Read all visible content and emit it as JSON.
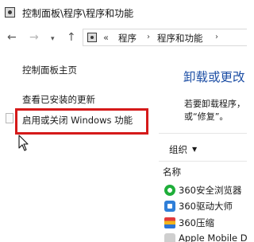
{
  "window": {
    "title": "控制面板\\程序\\程序和功能"
  },
  "navigation": {
    "back_icon": "←",
    "forward_icon": "→",
    "dropdown_icon": "▾",
    "up_icon": "↑"
  },
  "address_bar": {
    "overflow_chevron": "«",
    "segments": [
      "程序",
      "程序和功能"
    ],
    "separator": "›"
  },
  "left_pane": {
    "links": [
      "控制面板主页",
      "查看已安装的更新",
      "启用或关闭 Windows 功能"
    ]
  },
  "main": {
    "heading": "卸载或更改",
    "description_line1": "若要卸载程序，",
    "description_line2": "或“修复”。",
    "organize_label": "组织",
    "organize_arrow": "▼",
    "column_header": "名称",
    "programs": [
      {
        "name": "360安全浏览器",
        "icon": "360browser-icon"
      },
      {
        "name": "360驱动大师",
        "icon": "360driver-icon"
      },
      {
        "name": "360压缩",
        "icon": "360zip-icon"
      },
      {
        "name": "Apple Mobile D",
        "icon": "apple-mobile-icon"
      }
    ]
  },
  "colors": {
    "heading": "#1e4fa5",
    "highlight_border": "#d51a1a"
  }
}
